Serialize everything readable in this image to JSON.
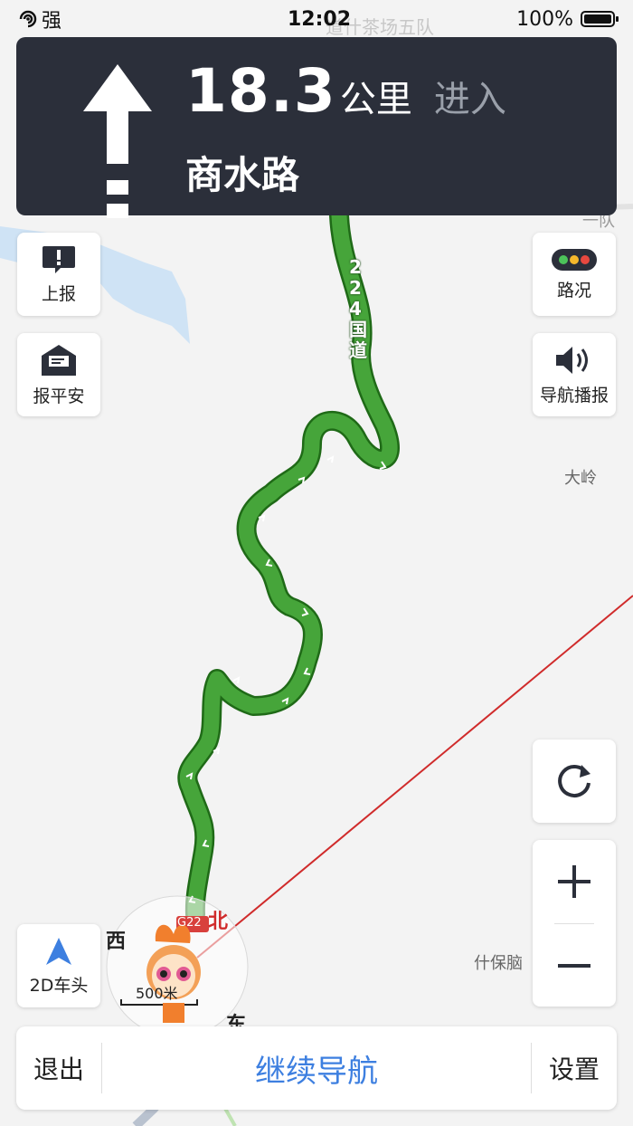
{
  "status_bar": {
    "signal": "强",
    "time": "12:02",
    "battery": "100%"
  },
  "navigation": {
    "distance": "18.3",
    "unit": "公里",
    "action": "进入",
    "road": "商水路"
  },
  "left_buttons": [
    {
      "label": "上报"
    },
    {
      "label": "报平安"
    }
  ],
  "right_buttons": [
    {
      "label": "路况"
    },
    {
      "label": "导航播报"
    }
  ],
  "map": {
    "route_label": "224国道",
    "place_labels": [
      "大岭",
      "什保脑",
      "一队"
    ],
    "highway_shield": "G22",
    "compass": {
      "north": "北",
      "west": "西",
      "east": "东"
    },
    "scale": "500米",
    "top_faded_label": "道什茶场五队"
  },
  "view_mode_label": "2D车头",
  "bottom_bar": {
    "exit": "退出",
    "continue": "继续导航",
    "settings": "设置"
  },
  "colors": {
    "route": "#46a53a",
    "panel": "#2b2f3a",
    "accent": "#3d7fe0"
  }
}
